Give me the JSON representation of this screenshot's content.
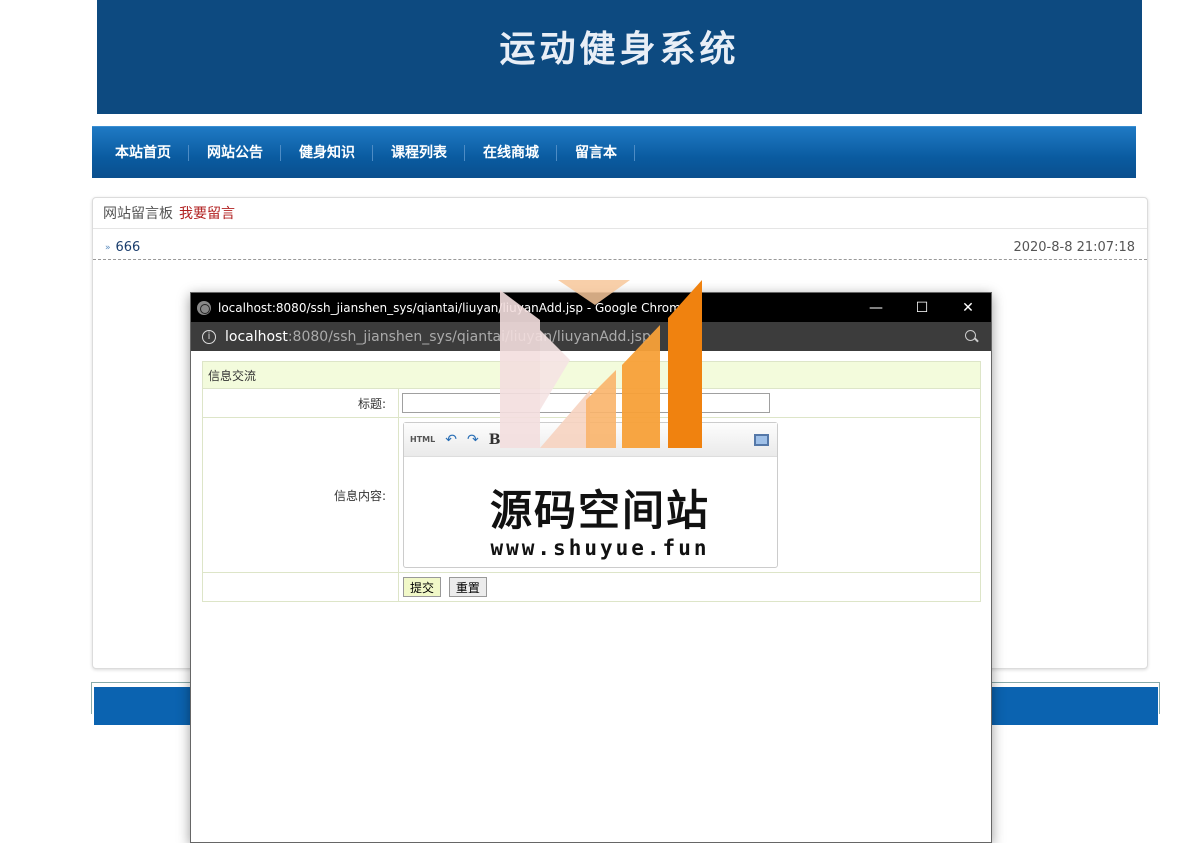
{
  "banner": {
    "title": "运动健身系统"
  },
  "nav": {
    "items": [
      "本站首页",
      "网站公告",
      "健身知识",
      "课程列表",
      "在线商城",
      "留言本"
    ]
  },
  "board": {
    "title": "网站留言板",
    "post_link": "我要留言",
    "messages": [
      {
        "title": "666",
        "date": "2020-8-8 21:07:18"
      }
    ]
  },
  "popup": {
    "window_title": "localhost:8080/ssh_jianshen_sys/qiantai/liuyan/liuyanAdd.jsp - Google Chrome",
    "url_host": "localhost",
    "url_path": ":8080/ssh_jianshen_sys/qiantai/liuyan/liuyanAdd.jsp",
    "form": {
      "header": "信息交流",
      "title_label": "标题:",
      "title_value": "",
      "content_label": "信息内容:",
      "toolbar": {
        "html": "HTML",
        "undo": "↶",
        "redo": "↷",
        "bold": "B"
      },
      "submit": "提交",
      "reset": "重置"
    }
  },
  "watermark": {
    "text": "源码空间站",
    "url": "www.shuyue.fun"
  },
  "colors": {
    "banner": "#0d4a80",
    "nav": "#0a5ba0",
    "footer": "#0b63b0",
    "link": "#b22222",
    "watermark_orange": "#f0820f"
  }
}
